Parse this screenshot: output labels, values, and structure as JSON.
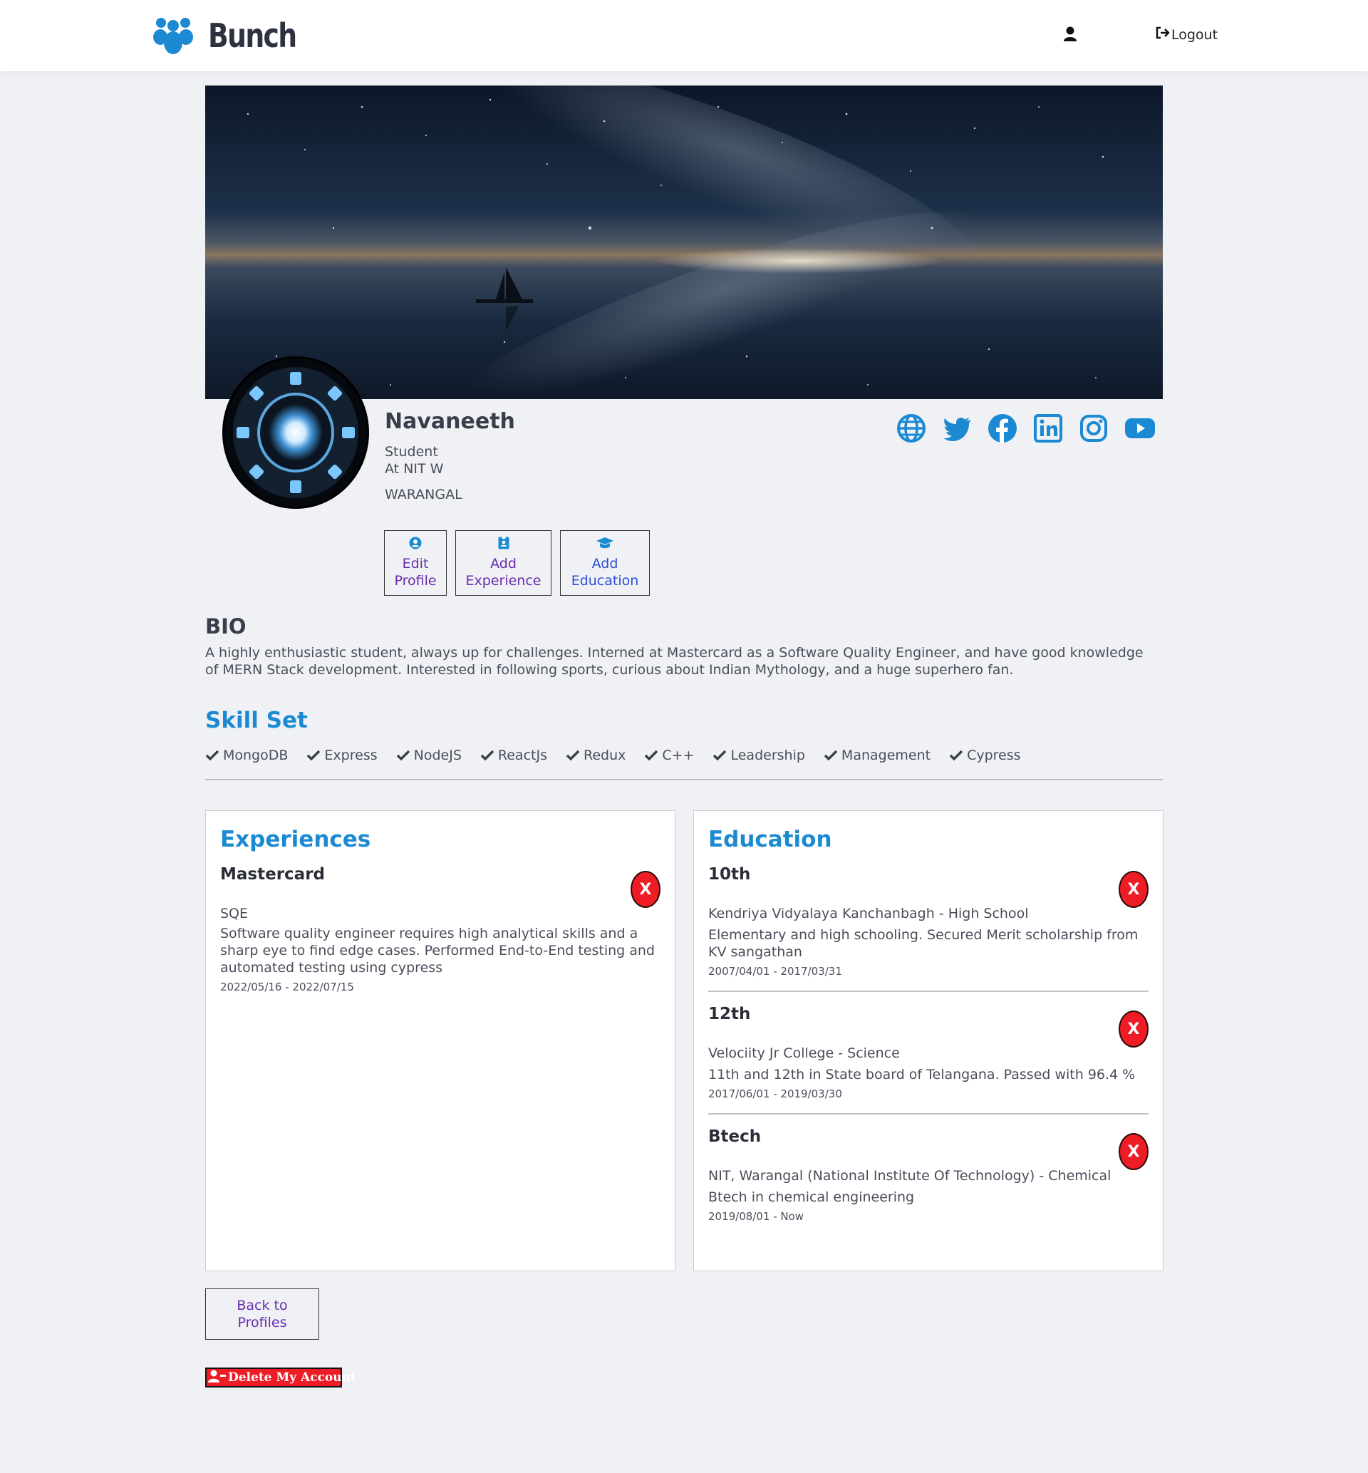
{
  "nav": {
    "brand": "Bunch",
    "logout_label": "Logout",
    "user_icon": "user-icon",
    "logout_icon": "sign-out-icon"
  },
  "profile": {
    "name": "Navaneeth",
    "status": "Student",
    "company": "At NIT W",
    "location": "WARANGAL",
    "socials": [
      "globe-icon",
      "twitter-icon",
      "facebook-icon",
      "linkedin-icon",
      "instagram-icon",
      "youtube-icon"
    ]
  },
  "actions": {
    "edit_line1": "Edit",
    "edit_line2": "Profile",
    "exp_line1": "Add",
    "exp_line2": "Experience",
    "edu_line1": "Add",
    "edu_line2": "Education"
  },
  "bio": {
    "title": "BIO",
    "text": "A highly enthusiastic student, always up for challenges. Interned at Mastercard as a Software Quality Engineer, and have good knowledge of MERN Stack development. Interested in following sports, curious about Indian Mythology, and a huge superhero fan."
  },
  "skills": {
    "title": "Skill Set",
    "items": [
      "MongoDB",
      "Express",
      "NodeJS",
      "ReactJs",
      "Redux",
      "C++",
      "Leadership",
      "Management",
      "Cypress"
    ]
  },
  "experiences": {
    "title": "Experiences",
    "items": [
      {
        "company": "Mastercard",
        "role": "SQE",
        "description": "Software quality engineer requires high analytical skills and a sharp eye to find edge cases. Performed End-to-End testing and automated testing using cypress",
        "dates": "2022/05/16 - 2022/07/15",
        "delete_label": "X"
      }
    ]
  },
  "education": {
    "title": "Education",
    "items": [
      {
        "degree": "10th",
        "school": "Kendriya Vidyalaya Kanchanbagh - High School",
        "description": "Elementary and high schooling. Secured Merit scholarship from KV sangathan",
        "dates": "2007/04/01 - 2017/03/31",
        "delete_label": "X"
      },
      {
        "degree": "12th",
        "school": "Velociity Jr College - Science",
        "description": "11th and 12th in State board of Telangana. Passed with 96.4 %",
        "dates": "2017/06/01 - 2019/03/30",
        "delete_label": "X"
      },
      {
        "degree": "Btech",
        "school": "NIT, Warangal (National Institute Of Technology) - Chemical",
        "description": "Btech in chemical engineering",
        "dates": "2019/08/01 - Now",
        "delete_label": "X"
      }
    ]
  },
  "footer": {
    "back_line1": "Back to",
    "back_line2": "Profiles",
    "delete_account": "Delete My Account"
  },
  "colors": {
    "accent": "#1b8ad3",
    "danger": "#ee1c24",
    "link": "#6a2bb0",
    "background": "#f0f1f5"
  }
}
